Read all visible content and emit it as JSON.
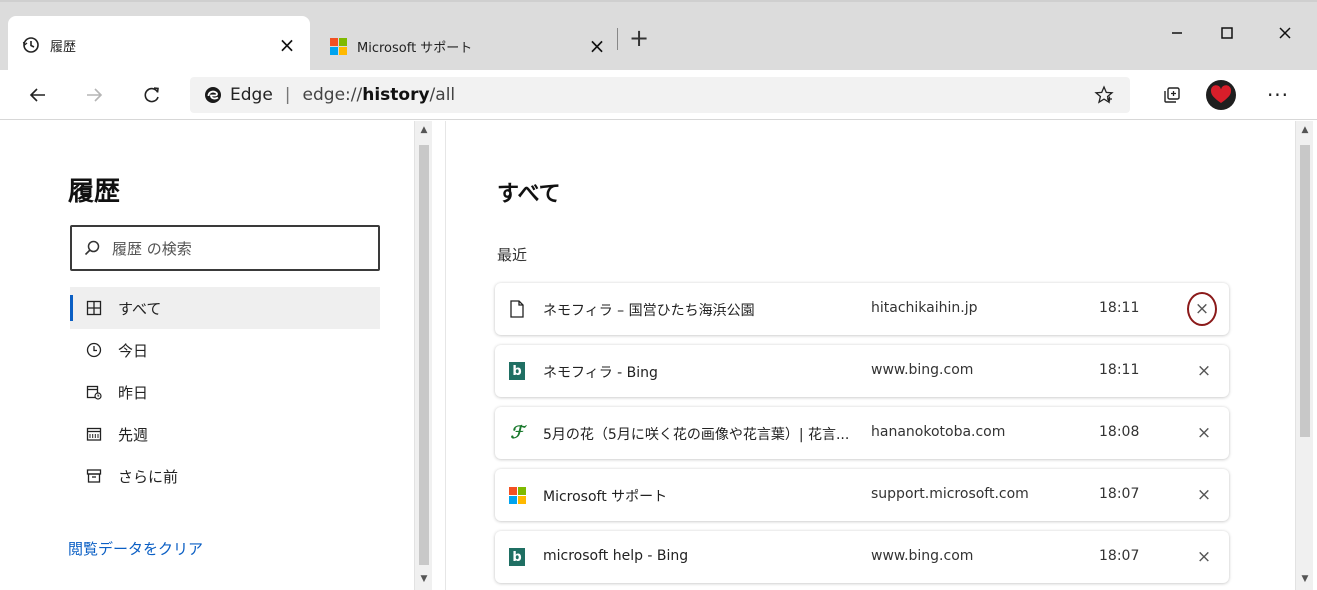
{
  "tabs": [
    {
      "title": "履歴",
      "icon": "history-icon",
      "active": true,
      "close_label": "×"
    },
    {
      "title": "Microsoft サポート",
      "icon": "microsoft-logo-icon",
      "active": false,
      "close_label": "×"
    }
  ],
  "new_tab_label": "+",
  "address": {
    "brand": "Edge",
    "separator": "|",
    "scheme": "edge://",
    "host": "history",
    "path": "/all"
  },
  "more_label": "···",
  "left_pane": {
    "title": "履歴",
    "search_placeholder": "履歴 の検索",
    "nav_items": [
      {
        "label": "すべて",
        "icon": "grid-icon",
        "selected": true
      },
      {
        "label": "今日",
        "icon": "clock-icon",
        "selected": false
      },
      {
        "label": "昨日",
        "icon": "calendar-yesterday-icon",
        "selected": false
      },
      {
        "label": "先週",
        "icon": "calendar-week-icon",
        "selected": false
      },
      {
        "label": "さらに前",
        "icon": "archive-icon",
        "selected": false
      }
    ],
    "clear_link": "閲覧データをクリア"
  },
  "right_pane": {
    "title": "すべて",
    "section": "最近",
    "items": [
      {
        "title": "ネモフィラ – 国営ひたち海浜公園",
        "domain": "hitachikaihin.jp",
        "time": "18:11",
        "favicon": "page-icon",
        "delete_label": "×",
        "delete_highlighted": true
      },
      {
        "title": "ネモフィラ - Bing",
        "domain": "www.bing.com",
        "time": "18:11",
        "favicon": "bing-icon",
        "delete_label": "×",
        "delete_highlighted": false
      },
      {
        "title": "5月の花（5月に咲く花の画像や花言葉）| 花言...",
        "domain": "hananokotoba.com",
        "time": "18:08",
        "favicon": "hananokotoba-icon",
        "delete_label": "×",
        "delete_highlighted": false
      },
      {
        "title": "Microsoft サポート",
        "domain": "support.microsoft.com",
        "time": "18:07",
        "favicon": "microsoft-logo-icon",
        "delete_label": "×",
        "delete_highlighted": false
      },
      {
        "title": "microsoft help - Bing",
        "domain": "www.bing.com",
        "time": "18:07",
        "favicon": "bing-icon",
        "delete_label": "×",
        "delete_highlighted": false
      }
    ]
  },
  "colors": {
    "accent": "#0b5fc4",
    "highlight_circle": "#8b1a1a",
    "microsoft_red": "#f25022",
    "microsoft_green": "#7fba00",
    "microsoft_blue": "#00a4ef",
    "microsoft_yellow": "#ffb900",
    "bing_teal": "#1f6f63"
  }
}
